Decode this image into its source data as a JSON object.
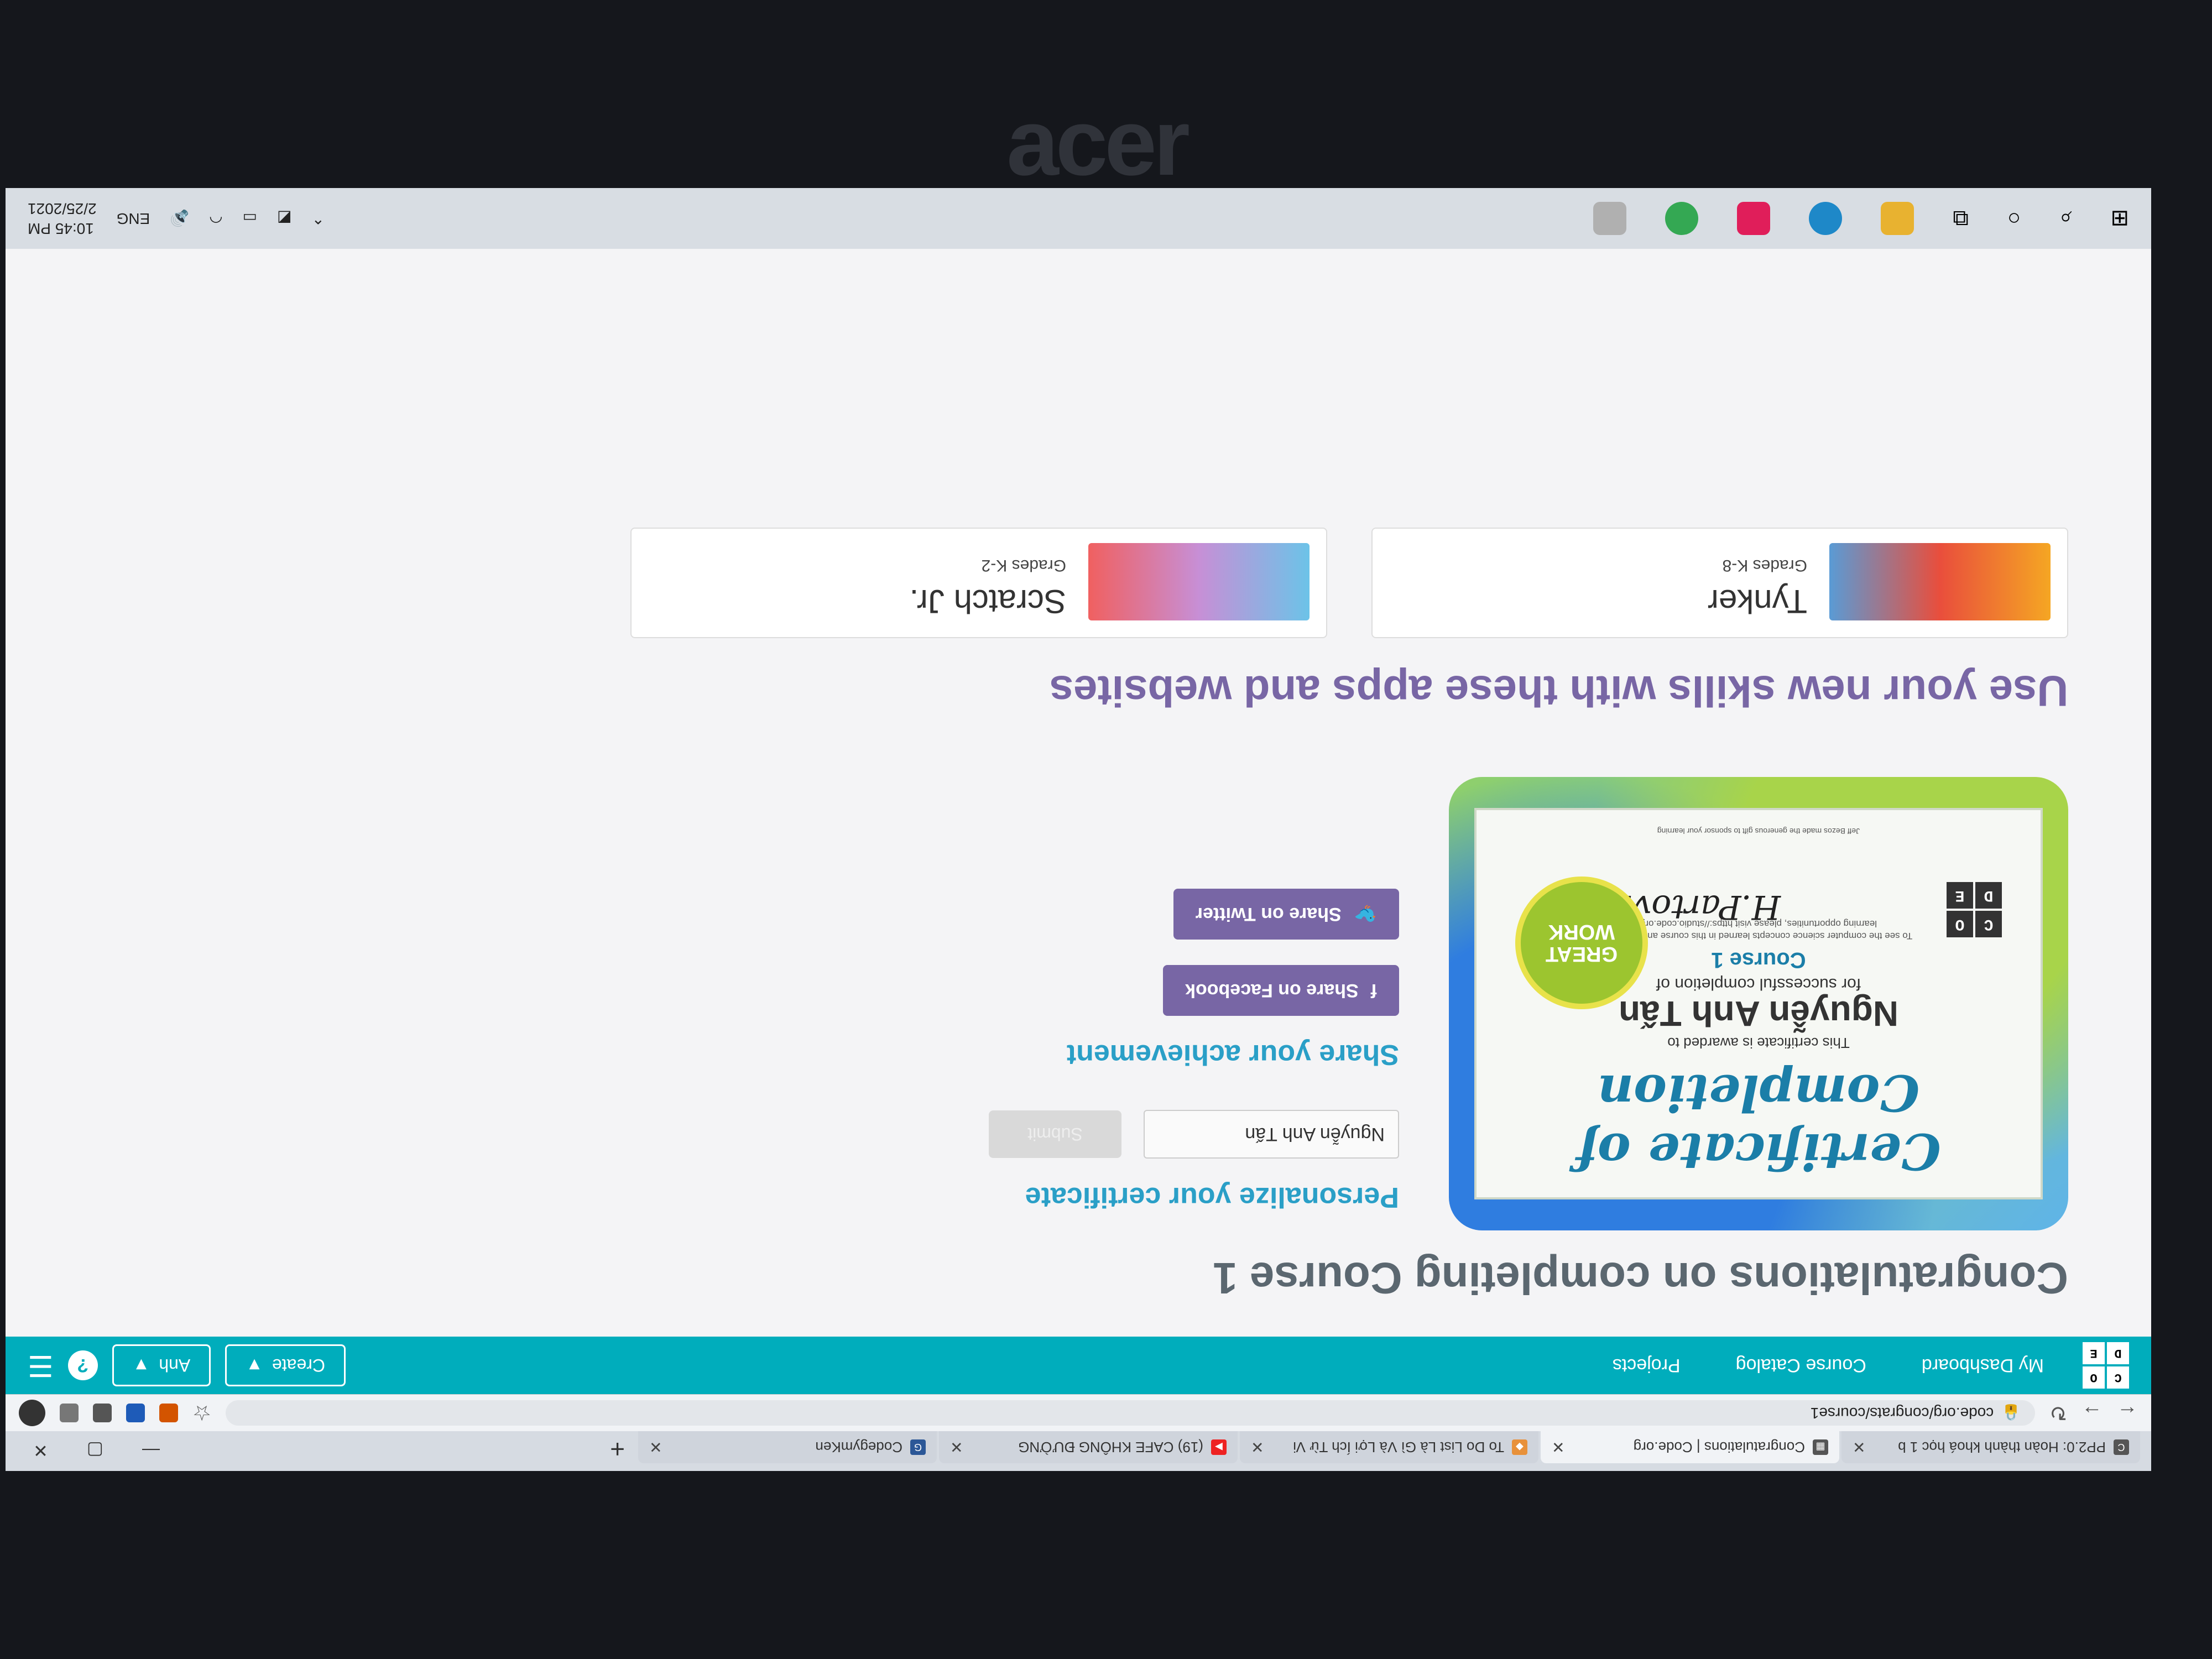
{
  "laptop_brand": "acer",
  "browser": {
    "tabs": [
      {
        "title": "PP2.0: Hoàn thành khoá học 1 b",
        "icon": "codeorg-icon"
      },
      {
        "title": "Congratulations | Code.org",
        "icon": "codeorg-grid-icon"
      },
      {
        "title": "To Do List Là Gì Và Lợi Ích Từ Vi",
        "icon": "diamond-icon"
      },
      {
        "title": "(19) CAFE KHÔNG ĐƯỜNG",
        "icon": "youtube-icon"
      },
      {
        "title": "CodegymKen",
        "icon": "codegym-icon"
      }
    ],
    "url": "code.org/congrats/course1"
  },
  "site": {
    "nav": [
      "My Dashboard",
      "Course Catalog",
      "Projects"
    ],
    "create_label": "Create",
    "user_label": "Anh",
    "help_label": "?",
    "logo_letters": [
      "C",
      "O",
      "D",
      "E"
    ]
  },
  "main": {
    "title": "Congratulations on completing Course 1",
    "certificate": {
      "heading": "Certificate of Completion",
      "awarded": "This certificate is awarded to",
      "name": "Nguyễn Anh Tấn",
      "for": "for successful completion of",
      "course": "Course 1",
      "small_text": "To see the computer science concepts learned in this course and for more learning opportunities, please visit https://studio.code.org",
      "signature": "H.Partovi",
      "badge_top": "GREAT",
      "badge_bottom": "WORK",
      "footer": "Jeff Bezos made the generous gift to sponsor your learning"
    },
    "personalize_heading": "Personalize your certificate",
    "name_value": "Nguyễn Anh Tấn",
    "submit_label": "Submit",
    "share_heading": "Share your achievement",
    "share_facebook": "Share on Facebook",
    "share_twitter": "Share on Twitter",
    "apps_heading": "Use your new skills with these apps and websites",
    "apps": [
      {
        "name": "Tynker",
        "grades": "Grades K-8"
      },
      {
        "name": "Scratch Jr.",
        "grades": "Grades K-2"
      }
    ]
  },
  "taskbar": {
    "lang": "ENG",
    "time": "10:45 PM",
    "date": "2/25/2021"
  },
  "colors": {
    "header": "#00adbc",
    "accent_purple": "#7866a5",
    "accent_blue": "#2a9fc7"
  }
}
